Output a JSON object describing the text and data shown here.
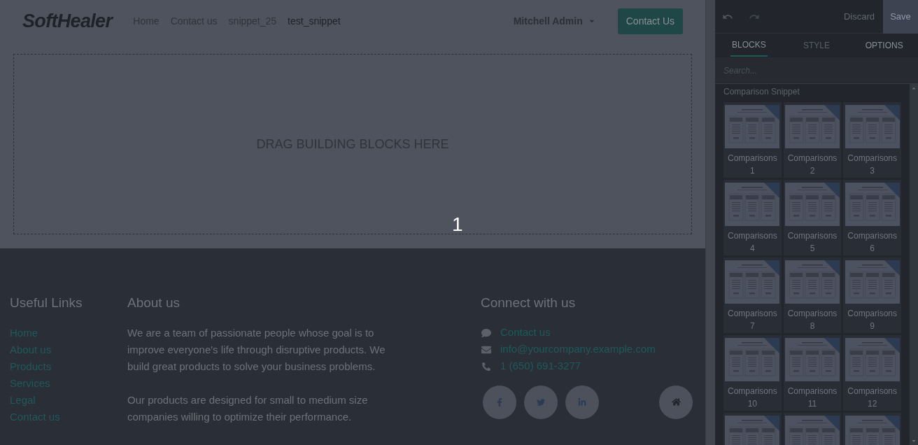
{
  "header": {
    "logo": "SoftHealer",
    "nav": [
      {
        "label": "Home",
        "selected": false
      },
      {
        "label": "Contact us",
        "selected": false
      },
      {
        "label": "snippet_25",
        "selected": false
      },
      {
        "label": "test_snippet",
        "selected": true
      }
    ],
    "user": "Mitchell Admin",
    "cta": "Contact Us"
  },
  "dropzone": {
    "text": "DRAG BUILDING BLOCKS HERE",
    "marker": "1"
  },
  "footer": {
    "links_title": "Useful Links",
    "links": [
      "Home",
      "About us",
      "Products",
      "Services",
      "Legal",
      "Contact us"
    ],
    "about_title": "About us",
    "about": [
      "We are a team of passionate people whose goal is to improve everyone's life through disruptive products. We build great products to solve your business problems.",
      "Our products are designed for small to medium size companies willing to optimize their performance."
    ],
    "connect_title": "Connect with us",
    "contacts": [
      {
        "kind": "chat",
        "text": "Contact us"
      },
      {
        "kind": "mail",
        "text": "info@yourcompany.example.com"
      },
      {
        "kind": "phone",
        "text": "1 (650) 691-3277"
      }
    ],
    "social": [
      {
        "kind": "facebook"
      },
      {
        "kind": "twitter"
      },
      {
        "kind": "linkedin"
      },
      {
        "kind": "home"
      }
    ]
  },
  "editor": {
    "discard": "Discard",
    "save": "Save",
    "tabs": [
      {
        "label": "BLOCKS",
        "selected": true,
        "disabled": false
      },
      {
        "label": "STYLE",
        "selected": false,
        "disabled": true
      },
      {
        "label": "OPTIONS",
        "selected": false,
        "disabled": false
      }
    ],
    "search": {
      "placeholder": "Search..."
    },
    "section": "Comparison Snippet",
    "blocks": [
      {
        "label": "Comparisons",
        "number": "1"
      },
      {
        "label": "Comparisons",
        "number": "2"
      },
      {
        "label": "Comparisons",
        "number": "3"
      },
      {
        "label": "Comparisons",
        "number": "4"
      },
      {
        "label": "Comparisons",
        "number": "5"
      },
      {
        "label": "Comparisons",
        "number": "6"
      },
      {
        "label": "Comparisons",
        "number": "7"
      },
      {
        "label": "Comparisons",
        "number": "8"
      },
      {
        "label": "Comparisons",
        "number": "9"
      },
      {
        "label": "Comparisons",
        "number": "10"
      },
      {
        "label": "Comparisons",
        "number": "11"
      },
      {
        "label": "Comparisons",
        "number": "12"
      }
    ]
  }
}
